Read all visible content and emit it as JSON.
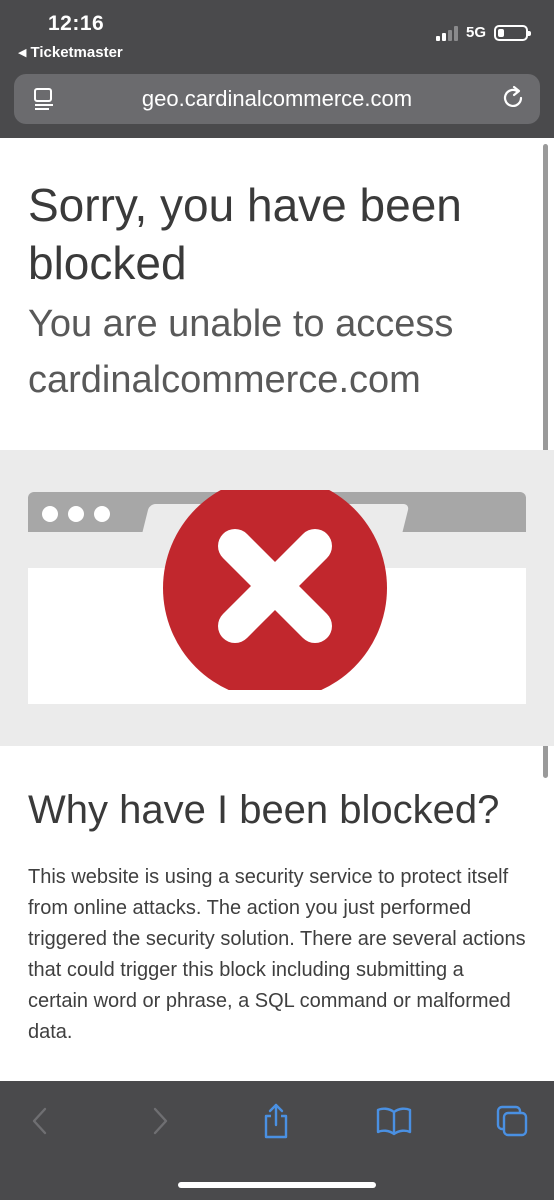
{
  "status_bar": {
    "time": "12:16",
    "back_app": "Ticketmaster",
    "network": "5G"
  },
  "address_bar": {
    "url": "geo.cardinalcommerce.com"
  },
  "page": {
    "title": "Sorry, you have been blocked",
    "subtitle": "You are unable to access cardinalcommerce.com",
    "why_heading": "Why have I been blocked?",
    "why_text": "This website is using a security service to protect itself from online attacks. The action you just performed triggered the security solution. There are several actions that could trigger this block including submitting a certain word or phrase, a SQL command or malformed data."
  },
  "icons": {
    "reader": "reader-icon",
    "reload": "reload-icon",
    "back": "chevron-left-icon",
    "forward": "chevron-right-icon",
    "share": "share-icon",
    "bookmarks": "book-icon",
    "tabs": "tabs-icon",
    "blocked": "x-circle-icon"
  },
  "colors": {
    "chrome": "#4a4a4c",
    "accent": "#4a90e2",
    "blocked_red": "#c1272d"
  }
}
